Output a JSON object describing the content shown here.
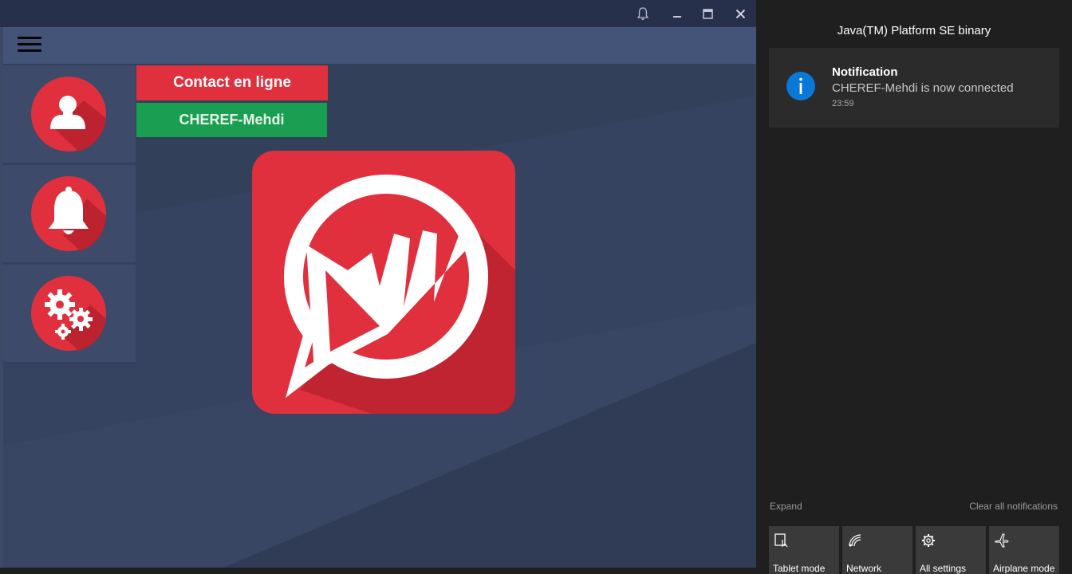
{
  "app": {
    "titlebar": {
      "icons": [
        "bell-icon",
        "minimize-icon",
        "maximize-icon",
        "close-icon"
      ]
    },
    "sidebar": {
      "items": [
        {
          "icon": "user-icon"
        },
        {
          "icon": "bell-icon"
        },
        {
          "icon": "gears-icon"
        }
      ]
    },
    "contact_button_label": "Contact en ligne",
    "connected_user": "CHEREF-Mehdi",
    "logo_icon": "chat-logo-icon",
    "colors": {
      "accent_red": "#e0303d",
      "accent_green": "#1a9f52",
      "header_blue": "#445378"
    }
  },
  "action_center": {
    "app_title": "Java(TM) Platform SE binary",
    "notification": {
      "icon": "info-icon",
      "title": "Notification",
      "body": "CHEREF-Mehdi is now connected",
      "time": "23:59"
    },
    "expand_label": "Expand",
    "clear_label": "Clear all notifications",
    "quick_actions": [
      {
        "icon": "tablet-mode-icon",
        "label": "Tablet mode"
      },
      {
        "icon": "network-icon",
        "label": "Network"
      },
      {
        "icon": "settings-icon",
        "label": "All settings"
      },
      {
        "icon": "airplane-icon",
        "label": "Airplane mode"
      }
    ]
  }
}
